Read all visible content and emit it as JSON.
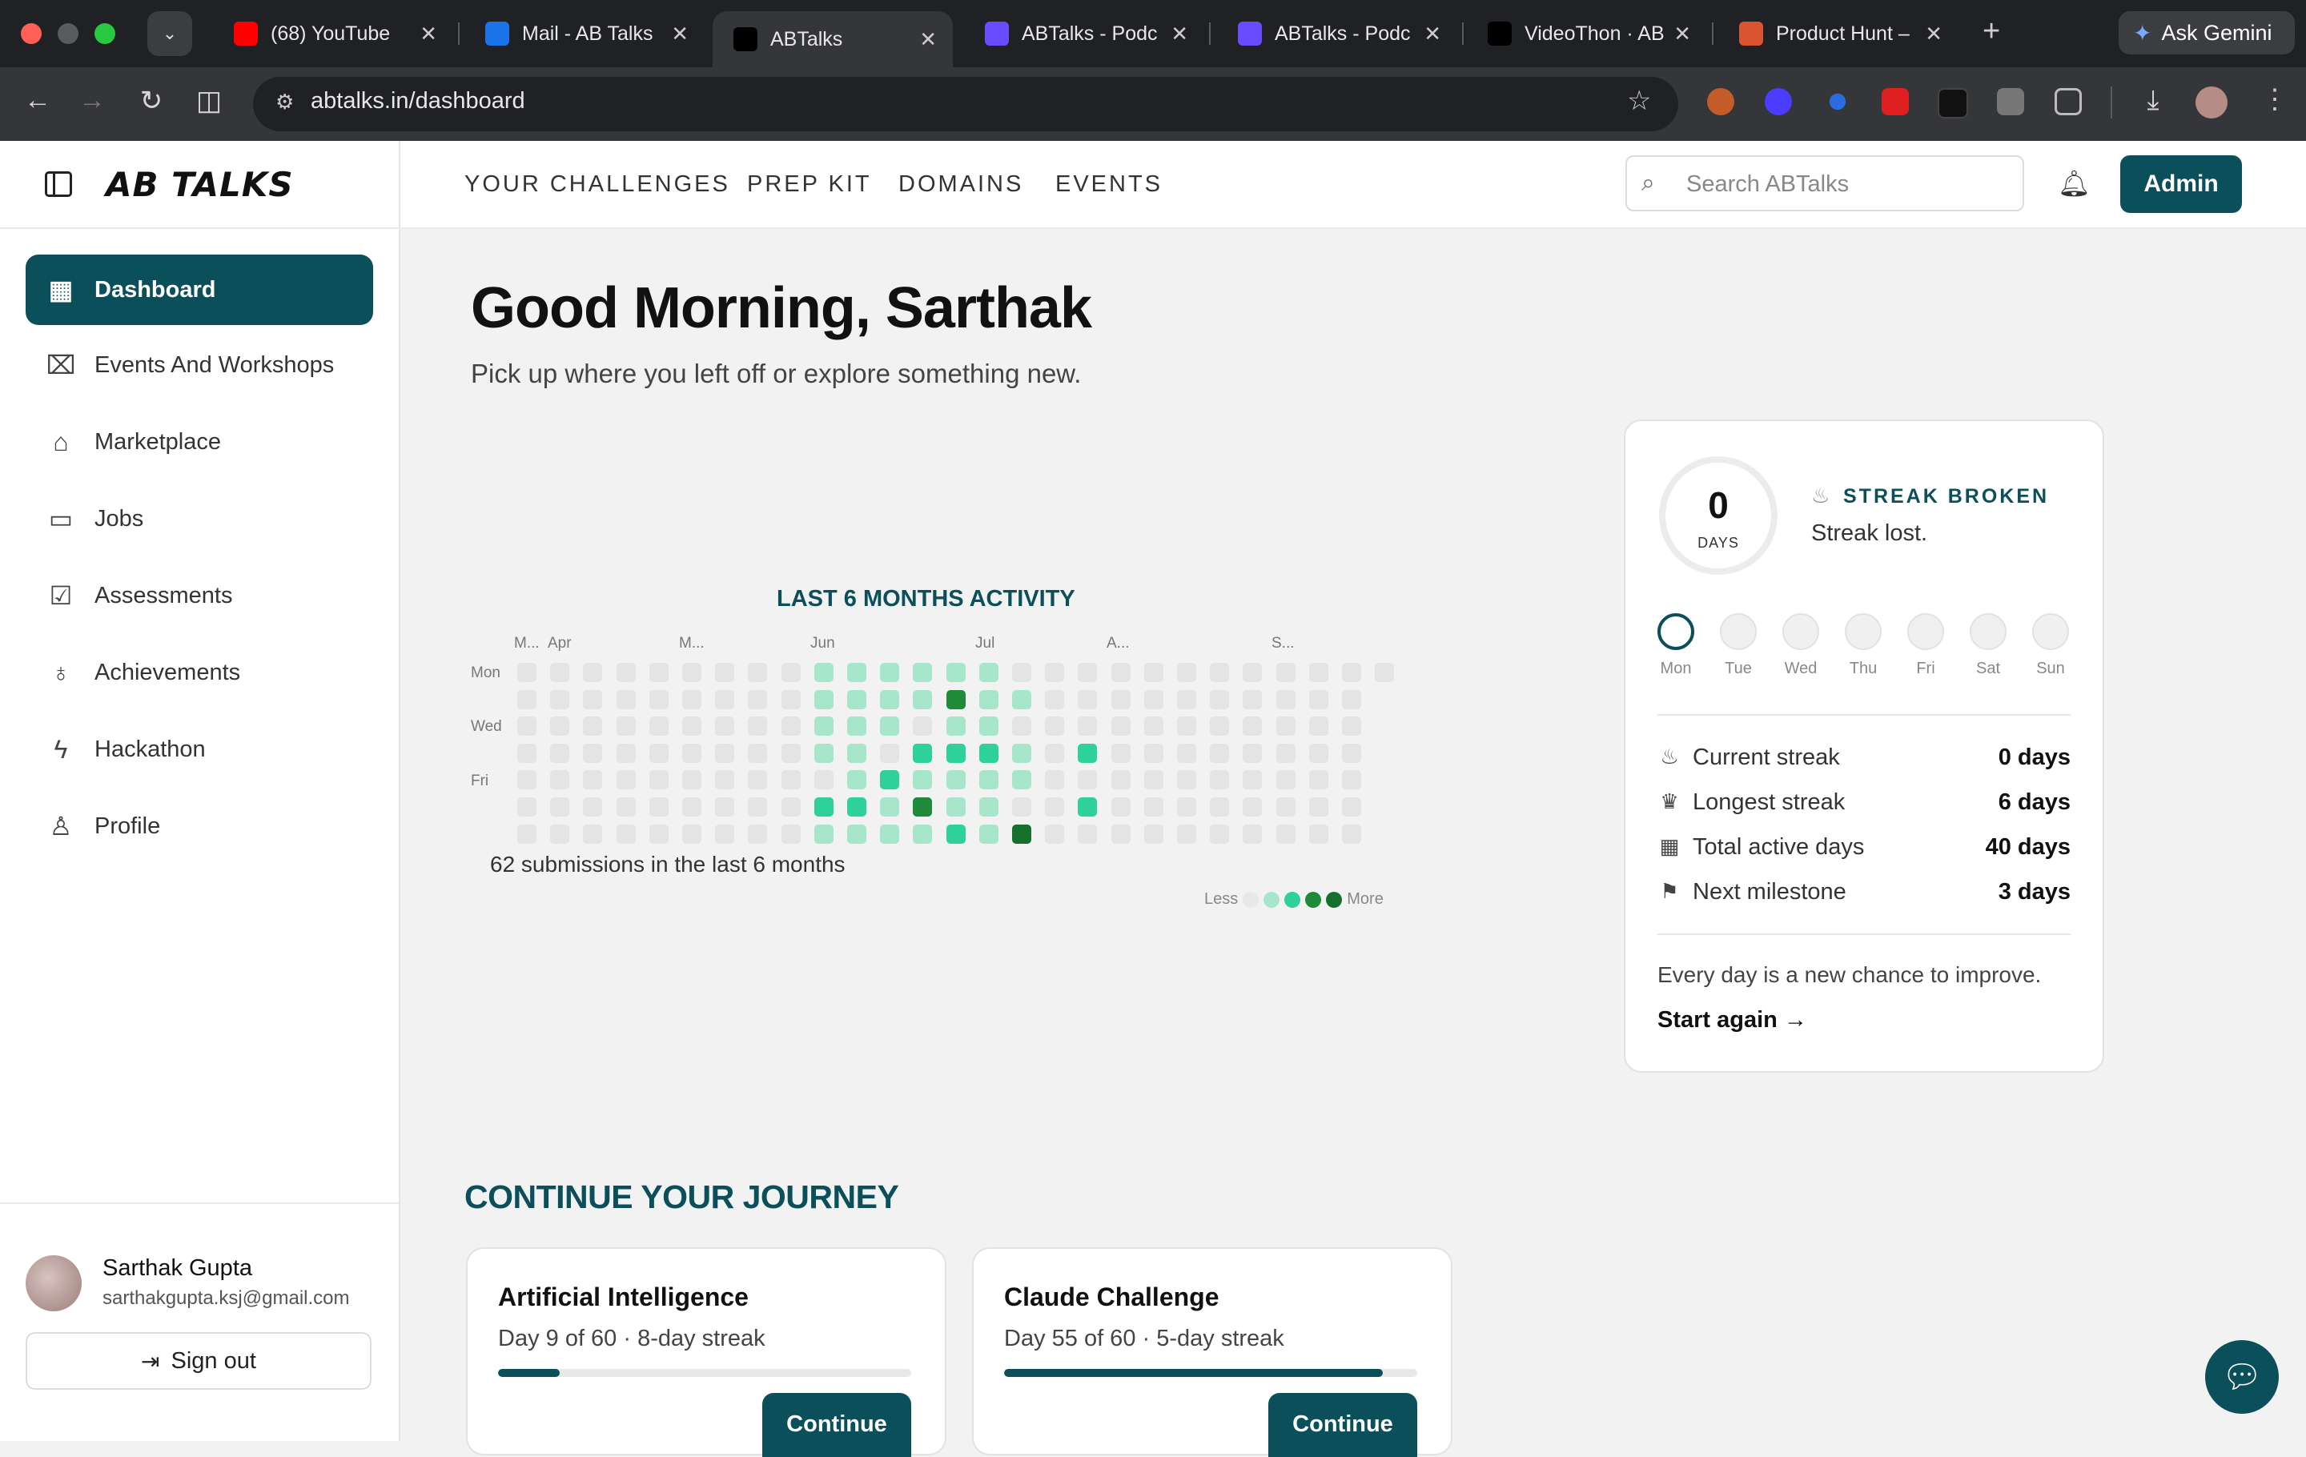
{
  "browser": {
    "tabs": [
      {
        "title": "(68) YouTube",
        "favicon_color": "#ff0000",
        "icon": "youtube-icon"
      },
      {
        "title": "Mail - AB Talks",
        "favicon_color": "#1a73e8",
        "icon": "outlook-icon"
      },
      {
        "title": "ABTalks",
        "favicon_color": "#000000",
        "icon": "abtalks-icon",
        "active": true
      },
      {
        "title": "ABTalks - Podc",
        "favicon_color": "#6a4cff",
        "icon": "podcast-icon"
      },
      {
        "title": "ABTalks - Podc",
        "favicon_color": "#6a4cff",
        "icon": "podcast-icon"
      },
      {
        "title": "VideoThon · AB",
        "favicon_color": "#000000",
        "icon": "abtalks-icon"
      },
      {
        "title": "Product Hunt –",
        "favicon_color": "#da552f",
        "icon": "product-hunt-icon"
      }
    ],
    "gemini_label": "Ask Gemini",
    "url": "abtalks.in/dashboard"
  },
  "sidebar": {
    "logo": "AB TALKS",
    "items": [
      {
        "label": "Dashboard",
        "icon": "grid-icon",
        "glyph": "▦",
        "active": true
      },
      {
        "label": "Events And Workshops",
        "icon": "presentation-icon",
        "glyph": "⌧"
      },
      {
        "label": "Marketplace",
        "icon": "store-icon",
        "glyph": "⌂"
      },
      {
        "label": "Jobs",
        "icon": "briefcase-icon",
        "glyph": "▭"
      },
      {
        "label": "Assessments",
        "icon": "clipboard-check-icon",
        "glyph": "☑"
      },
      {
        "label": "Achievements",
        "icon": "award-icon",
        "glyph": "♁"
      },
      {
        "label": "Hackathon",
        "icon": "zap-icon",
        "glyph": "ϟ"
      },
      {
        "label": "Profile",
        "icon": "user-icon",
        "glyph": "♙"
      }
    ],
    "user": {
      "name": "Sarthak Gupta",
      "email": "sarthakgupta.ksj@gmail.com"
    },
    "signout_label": "Sign out"
  },
  "topnav": {
    "links": [
      "YOUR CHALLENGES",
      "PREP KIT",
      "DOMAINS",
      "EVENTS"
    ],
    "search_placeholder": "Search ABTalks",
    "admin_label": "Admin"
  },
  "greeting": {
    "title": "Good Morning, Sarthak",
    "subtitle": "Pick up where you left off or explore something new."
  },
  "activity": {
    "title": "LAST 6 MONTHS ACTIVITY",
    "months": [
      "M...",
      "Apr",
      "M...",
      "Jun",
      "Jul",
      "A...",
      "S..."
    ],
    "weekdays": [
      "Mon",
      "Wed",
      "Fri"
    ],
    "summary": "62 submissions in the last 6 months",
    "legend_less": "Less",
    "legend_more": "More",
    "levels_colors": [
      "#e4e4e4",
      "#a8e6cc",
      "#2fd19b",
      "#1f8a3a",
      "#14702c"
    ],
    "heatmap_weeks": [
      [
        0,
        0,
        0,
        0,
        0,
        0,
        0
      ],
      [
        0,
        0,
        0,
        0,
        0,
        0,
        0
      ],
      [
        0,
        0,
        0,
        0,
        0,
        0,
        0
      ],
      [
        0,
        0,
        0,
        0,
        0,
        0,
        0
      ],
      [
        0,
        0,
        0,
        0,
        0,
        0,
        0
      ],
      [
        0,
        0,
        0,
        0,
        0,
        0,
        0
      ],
      [
        0,
        0,
        0,
        0,
        0,
        0,
        0
      ],
      [
        0,
        0,
        0,
        0,
        0,
        0,
        0
      ],
      [
        0,
        0,
        0,
        0,
        0,
        0,
        0
      ],
      [
        1,
        1,
        1,
        1,
        0,
        2,
        1
      ],
      [
        1,
        1,
        1,
        1,
        1,
        2,
        1
      ],
      [
        1,
        1,
        1,
        0,
        2,
        1,
        1
      ],
      [
        1,
        1,
        0,
        2,
        1,
        3,
        1
      ],
      [
        1,
        3,
        1,
        2,
        1,
        1,
        2
      ],
      [
        1,
        1,
        1,
        2,
        1,
        1,
        1
      ],
      [
        0,
        1,
        0,
        1,
        1,
        0,
        4
      ],
      [
        0,
        0,
        0,
        0,
        0,
        0,
        0
      ],
      [
        0,
        0,
        0,
        2,
        0,
        2,
        0
      ],
      [
        0,
        0,
        0,
        0,
        0,
        0,
        0
      ],
      [
        0,
        0,
        0,
        0,
        0,
        0,
        0
      ],
      [
        0,
        0,
        0,
        0,
        0,
        0,
        0
      ],
      [
        0,
        0,
        0,
        0,
        0,
        0,
        0
      ],
      [
        0,
        0,
        0,
        0,
        0,
        0,
        0
      ],
      [
        0,
        0,
        0,
        0,
        0,
        0,
        0
      ],
      [
        0,
        0,
        0,
        0,
        0,
        0,
        0
      ],
      [
        0,
        0,
        0,
        0,
        0,
        0,
        0
      ],
      [
        0
      ]
    ]
  },
  "streak": {
    "days_value": "0",
    "days_label": "DAYS",
    "status": "STREAK BROKEN",
    "status_text": "Streak lost.",
    "weekdays": [
      "Mon",
      "Tue",
      "Wed",
      "Thu",
      "Fri",
      "Sat",
      "Sun"
    ],
    "stats": [
      {
        "label": "Current streak",
        "value": "0 days",
        "icon": "flame-icon",
        "glyph": "♨"
      },
      {
        "label": "Longest streak",
        "value": "6 days",
        "icon": "trophy-icon",
        "glyph": "♛"
      },
      {
        "label": "Total active days",
        "value": "40 days",
        "icon": "calendar-icon",
        "glyph": "▦"
      },
      {
        "label": "Next milestone",
        "value": "3 days",
        "icon": "flag-icon",
        "glyph": "⚑"
      }
    ],
    "motto": "Every day is a new chance to improve.",
    "cta": "Start again →"
  },
  "journey": {
    "title": "CONTINUE YOUR JOURNEY",
    "cards": [
      {
        "title": "Artificial Intelligence",
        "subtitle": "Day 9 of 60 · 8-day streak",
        "progress": 0.15,
        "button": "Continue"
      },
      {
        "title": "Claude Challenge",
        "subtitle": "Day 55 of 60 · 5-day streak",
        "progress": 0.917,
        "button": "Continue"
      }
    ]
  }
}
